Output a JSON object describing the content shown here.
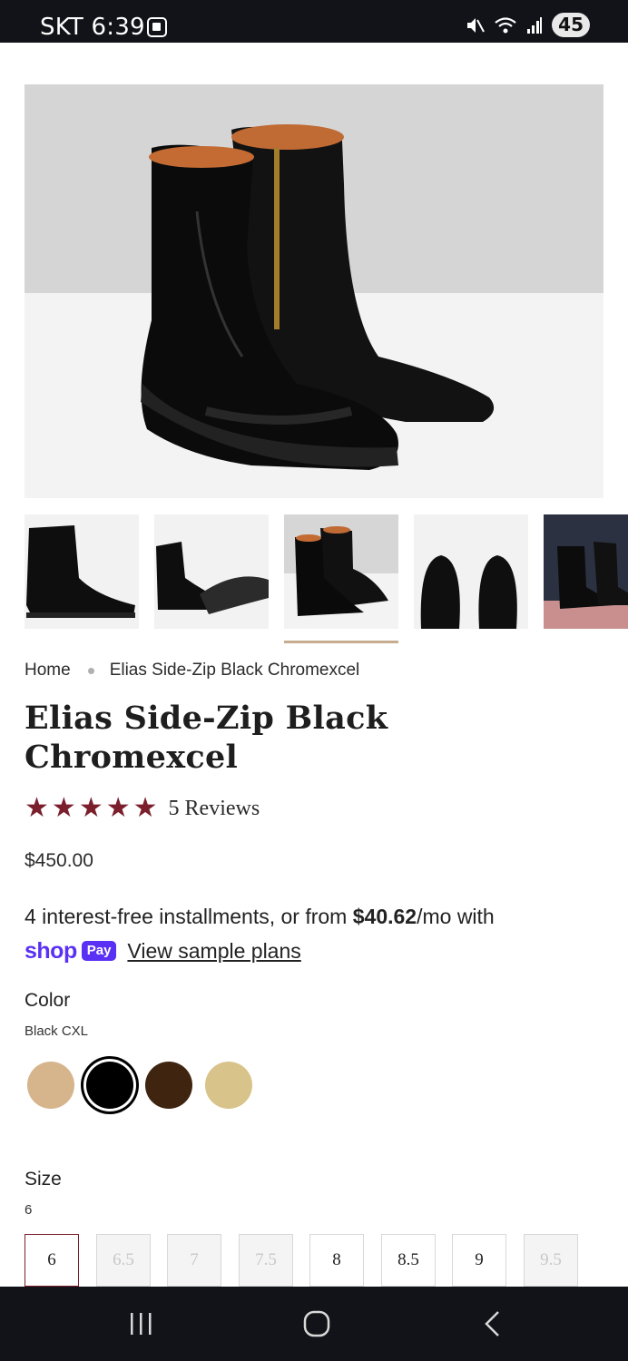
{
  "status_bar": {
    "carrier": "SKT",
    "time": "6:39",
    "battery": "45"
  },
  "breadcrumb": {
    "home": "Home",
    "current": "Elias Side-Zip Black Chromexcel"
  },
  "product": {
    "title": "Elias Side-Zip Black Chromexcel",
    "rating_stars": 5,
    "reviews": "5 Reviews",
    "price": "$450.00"
  },
  "installments": {
    "text_before": "4 interest-free installments, or from ",
    "amount": "$40.62",
    "text_after": "/mo with",
    "shop_logo": "shop",
    "pay_badge": "Pay",
    "link": "View sample plans"
  },
  "color": {
    "label": "Color",
    "selected": "Black CXL",
    "swatches": [
      {
        "color": "#d6b58c",
        "selected": false
      },
      {
        "color": "#000000",
        "selected": true
      },
      {
        "color": "#3f2410",
        "selected": false
      },
      {
        "color": "#d8c38a",
        "selected": false
      }
    ]
  },
  "size": {
    "label": "Size",
    "selected": "6",
    "options": [
      {
        "label": "6",
        "state": "selected"
      },
      {
        "label": "6.5",
        "state": "disabled"
      },
      {
        "label": "7",
        "state": "disabled"
      },
      {
        "label": "7.5",
        "state": "disabled"
      },
      {
        "label": "8",
        "state": "available"
      },
      {
        "label": "8.5",
        "state": "available"
      },
      {
        "label": "9",
        "state": "available"
      },
      {
        "label": "9.5",
        "state": "disabled"
      }
    ]
  },
  "thumbnails": {
    "count": 5,
    "active_index": 2
  },
  "icons": {
    "status": [
      "screenshot-icon",
      "mute-icon",
      "wifi-icon",
      "signal-icon"
    ],
    "nav": [
      "recent-apps-icon",
      "home-icon",
      "back-icon"
    ]
  }
}
